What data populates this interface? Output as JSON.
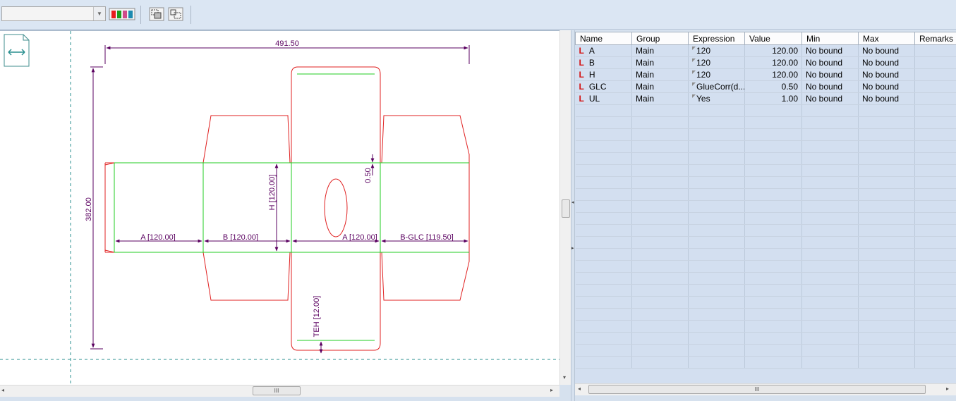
{
  "toolbar": {
    "combo_value": "",
    "combo_icon": "chevron-down-icon",
    "buttons": [
      "color-palette-icon",
      "layers-icon",
      "frame-icon"
    ]
  },
  "drawing": {
    "side_icon": "mirror-horizontal-icon",
    "dims": {
      "width_total": "491.50",
      "height_total": "382.00",
      "a1": "A [120.00]",
      "b": "B [120.00]",
      "a2": "A [120.00]",
      "bglc": "B-GLC [119.50]",
      "h": "H [120.00]",
      "gap": "0.50",
      "teh": "TEH [12.00]"
    },
    "colors": {
      "cut": "#e02020",
      "crease": "#22cc22",
      "dimension": "#5a0060",
      "guide": "#2a8f8f"
    }
  },
  "grid": {
    "columns": [
      "Name",
      "Group",
      "Expression",
      "Value",
      "Min",
      "Max",
      "Remarks"
    ],
    "rows": [
      {
        "icon": "L",
        "name": "A",
        "group": "Main",
        "expression": "120",
        "value": "120.00",
        "min": "No bound",
        "max": "No bound",
        "remarks": ""
      },
      {
        "icon": "L",
        "name": "B",
        "group": "Main",
        "expression": "120",
        "value": "120.00",
        "min": "No bound",
        "max": "No bound",
        "remarks": ""
      },
      {
        "icon": "L",
        "name": "H",
        "group": "Main",
        "expression": "120",
        "value": "120.00",
        "min": "No bound",
        "max": "No bound",
        "remarks": ""
      },
      {
        "icon": "L",
        "name": "GLC",
        "group": "Main",
        "expression": "GlueCorr(d...",
        "value": "0.50",
        "min": "No bound",
        "max": "No bound",
        "remarks": ""
      },
      {
        "icon": "L",
        "name": "UL",
        "group": "Main",
        "expression": "Yes",
        "value": "1.00",
        "min": "No bound",
        "max": "No bound",
        "remarks": ""
      }
    ],
    "empty_rows": 22
  },
  "scroll": {
    "thumb_grip": "III",
    "left_arrow": "◂",
    "right_arrow": "▸"
  }
}
